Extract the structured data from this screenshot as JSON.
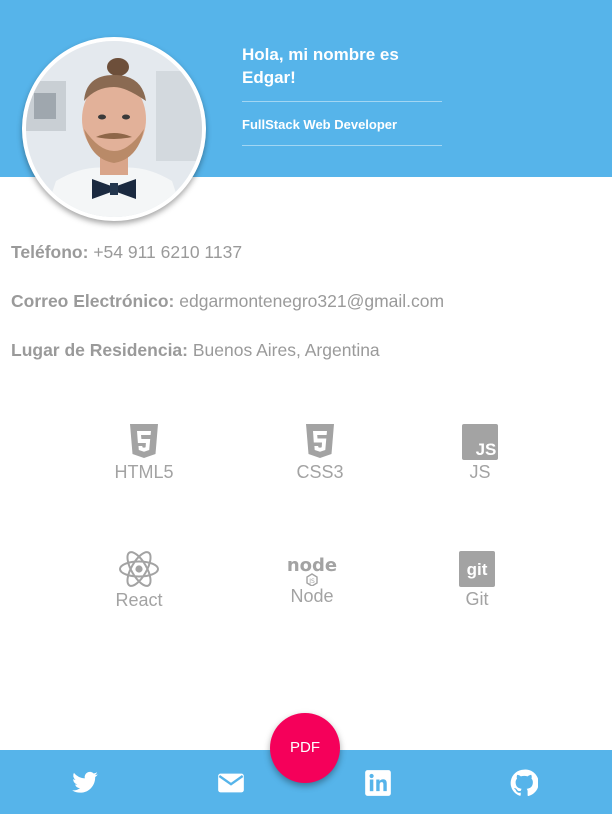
{
  "profile": {
    "greeting": "Hola, mi nombre es Edgar!",
    "role": "FullStack Web Developer",
    "avatar_icon": "profile-photo"
  },
  "contact": {
    "phone_label": "Teléfono:",
    "phone_value": "+54 911 6210 1137",
    "email_label": "Correo Electrónico:",
    "email_value": "edgarmontenegro321@gmail.com",
    "residence_label": "Lugar de Residencia:",
    "residence_value": "Buenos Aires, Argentina"
  },
  "skills": [
    {
      "name": "HTML5",
      "icon": "html5-icon"
    },
    {
      "name": "CSS3",
      "icon": "css3-icon"
    },
    {
      "name": "JS",
      "icon": "js-icon"
    },
    {
      "name": "React",
      "icon": "react-icon"
    },
    {
      "name": "Node",
      "icon": "node-icon"
    },
    {
      "name": "Git",
      "icon": "git-icon"
    }
  ],
  "footer": {
    "pdf_label": "PDF",
    "links": [
      {
        "icon": "twitter-icon"
      },
      {
        "icon": "mail-icon"
      },
      {
        "icon": "linkedin-icon"
      },
      {
        "icon": "github-icon"
      }
    ]
  },
  "colors": {
    "header_bg": "#56b4ea",
    "fab_bg": "#f5005a",
    "text_gray": "#9a9a9a",
    "icon_gray": "#a3a3a3"
  }
}
